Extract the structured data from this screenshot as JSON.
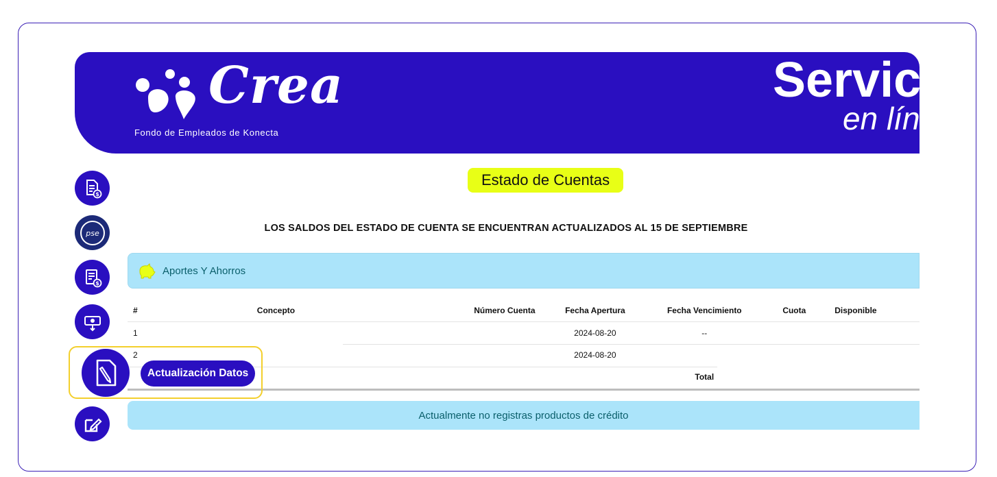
{
  "banner": {
    "logo_word": "Crea",
    "tagline": "Fondo de Empleados de Konecta",
    "service_title": "Servici",
    "service_subtitle": "en lín"
  },
  "rail": {
    "items": [
      {
        "icon": "document-money-icon"
      },
      {
        "icon": "pse-icon",
        "label": "pse"
      },
      {
        "icon": "statement-money-icon"
      },
      {
        "icon": "cash-withdraw-icon"
      },
      {
        "icon": "update-data-icon"
      },
      {
        "icon": "edit-form-icon"
      }
    ]
  },
  "tooltip": {
    "label": "Actualización Datos"
  },
  "main": {
    "title": "Estado de Cuentas",
    "notice": "LOS SALDOS DEL ESTADO DE CUENTA SE ENCUENTRAN ACTUALIZADOS AL 15 DE SEPTIEMBRE",
    "savings_section": "Aportes Y Ahorros",
    "table": {
      "headers": [
        "#",
        "Concepto",
        "Número Cuenta",
        "Fecha Apertura",
        "Fecha Vencimiento",
        "Cuota",
        "Disponible"
      ],
      "rows": [
        [
          "1",
          "",
          "",
          "2024-08-20",
          "--",
          "",
          ""
        ],
        [
          "2",
          "",
          "",
          "2024-08-20",
          "",
          "",
          ""
        ]
      ],
      "total_label": "Total"
    },
    "credit_message": "Actualmente no registras productos de crédito"
  },
  "colors": {
    "brand": "#2a0fc0",
    "highlight": "#e8ff16",
    "section_bg": "#abe4fa",
    "tooltip_border": "#f3cf2c"
  }
}
